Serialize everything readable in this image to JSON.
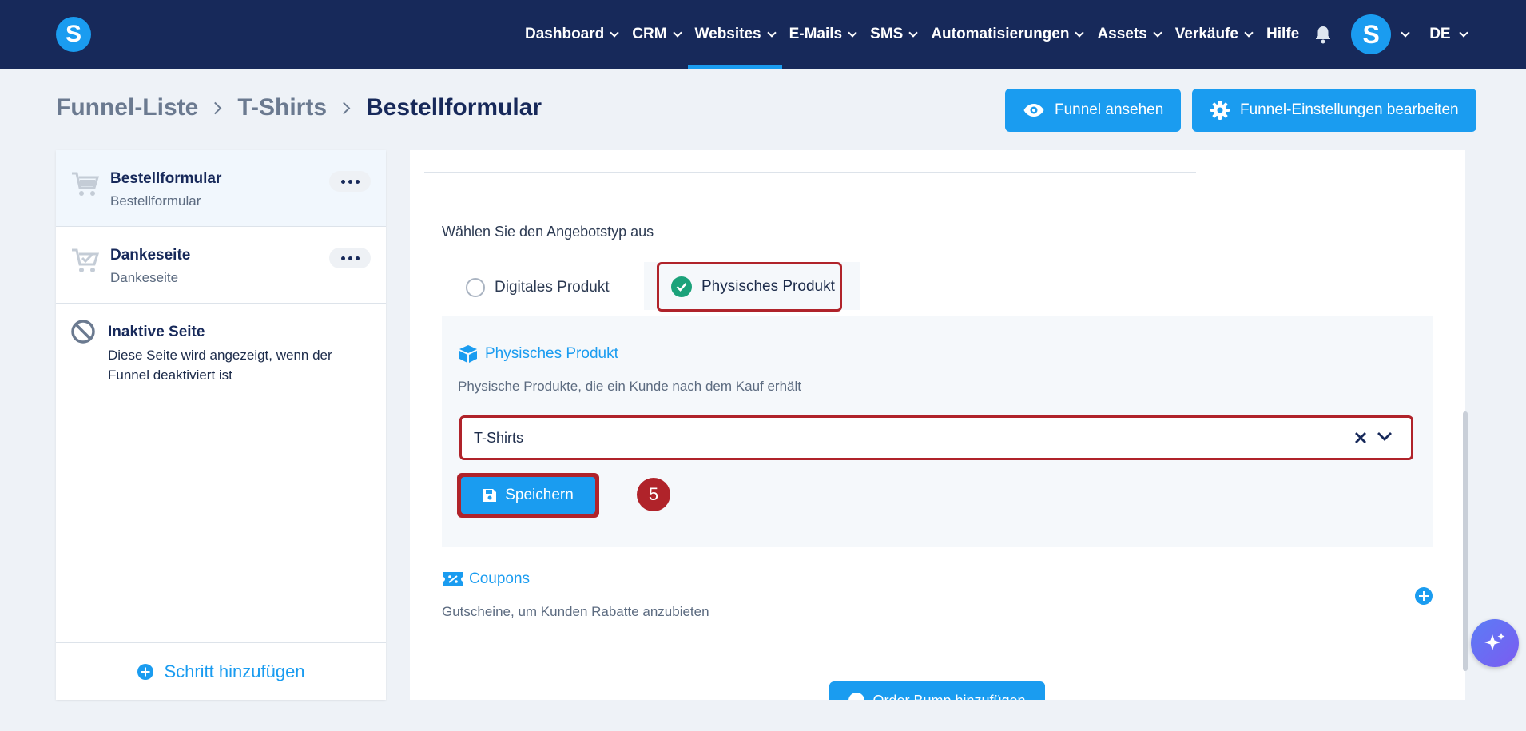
{
  "app": {
    "logo_letter": "S",
    "brand_color": "#1a9cf0",
    "nav_bg": "#17295a",
    "highlight_color": "#b0232a"
  },
  "nav": {
    "items": [
      {
        "label": "Dashboard",
        "dropdown": true,
        "active": false
      },
      {
        "label": "CRM",
        "dropdown": true,
        "active": false
      },
      {
        "label": "Websites",
        "dropdown": true,
        "active": true
      },
      {
        "label": "E-Mails",
        "dropdown": true,
        "active": false
      },
      {
        "label": "SMS",
        "dropdown": true,
        "active": false
      },
      {
        "label": "Automatisierungen",
        "dropdown": true,
        "active": false
      },
      {
        "label": "Assets",
        "dropdown": true,
        "active": false
      },
      {
        "label": "Verkäufe",
        "dropdown": true,
        "active": false
      },
      {
        "label": "Hilfe",
        "dropdown": false,
        "active": false
      }
    ],
    "notification_icon": "bell-icon",
    "avatar_letter": "S",
    "language": "DE"
  },
  "breadcrumb": {
    "items": [
      "Funnel-Liste",
      "T-Shirts",
      "Bestellformular"
    ]
  },
  "header_actions": {
    "view_funnel": "Funnel ansehen",
    "edit_settings": "Funnel-Einstellungen bearbeiten"
  },
  "sidebar": {
    "steps": [
      {
        "title": "Bestellformular",
        "subtitle": "Bestellformular",
        "icon": "cart-icon",
        "active": true
      },
      {
        "title": "Dankeseite",
        "subtitle": "Dankeseite",
        "icon": "cart-check-icon",
        "active": false
      }
    ],
    "inactive": {
      "title": "Inaktive Seite",
      "description": "Diese Seite wird angezeigt, wenn der Funnel deaktiviert ist",
      "icon": "ban-icon"
    },
    "add_step": "Schritt hinzufügen"
  },
  "offer": {
    "label": "Wählen Sie den Angebotstyp aus",
    "options": [
      {
        "label": "Digitales Produkt",
        "selected": false
      },
      {
        "label": "Physisches Produkt",
        "selected": true
      }
    ]
  },
  "physical": {
    "title": "Physisches Produkt",
    "description": "Physische Produkte, die ein Kunde nach dem Kauf erhält",
    "selected_value": "T-Shirts",
    "save_label": "Speichern",
    "step_marker": "5"
  },
  "coupons": {
    "title": "Coupons",
    "description": "Gutscheine, um Kunden Rabatte anzubieten"
  },
  "order_bump": {
    "label": "Order Bump hinzufügen"
  }
}
